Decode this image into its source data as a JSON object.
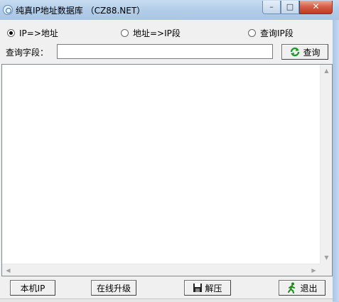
{
  "window": {
    "title": "纯真IP地址数据库 （CZ88.NET）"
  },
  "titlebar": {
    "minimize_glyph": "–",
    "maximize_glyph": "□",
    "close_glyph": "✕"
  },
  "modes": {
    "options": [
      {
        "label": "IP=>地址",
        "checked": true
      },
      {
        "label": "地址=>IP段",
        "checked": false
      },
      {
        "label": "查询IP段",
        "checked": false
      }
    ]
  },
  "query": {
    "field_label": "查询字段：",
    "value": "",
    "button_label": "查询"
  },
  "results": {
    "text": ""
  },
  "footer": {
    "local_ip_label": "本机IP",
    "online_upgrade_label": "在线升级",
    "extract_label": "解压",
    "exit_label": "退出"
  },
  "colors": {
    "frame": "#b9d1ea",
    "client_bg": "#f0f0f0",
    "close_button": "#c2391f",
    "refresh_icon": "#1e9a2a",
    "exit_icon": "#1a8c1a"
  },
  "icons": [
    "app-icon",
    "refresh-icon",
    "save-disk-icon",
    "running-man-icon"
  ]
}
